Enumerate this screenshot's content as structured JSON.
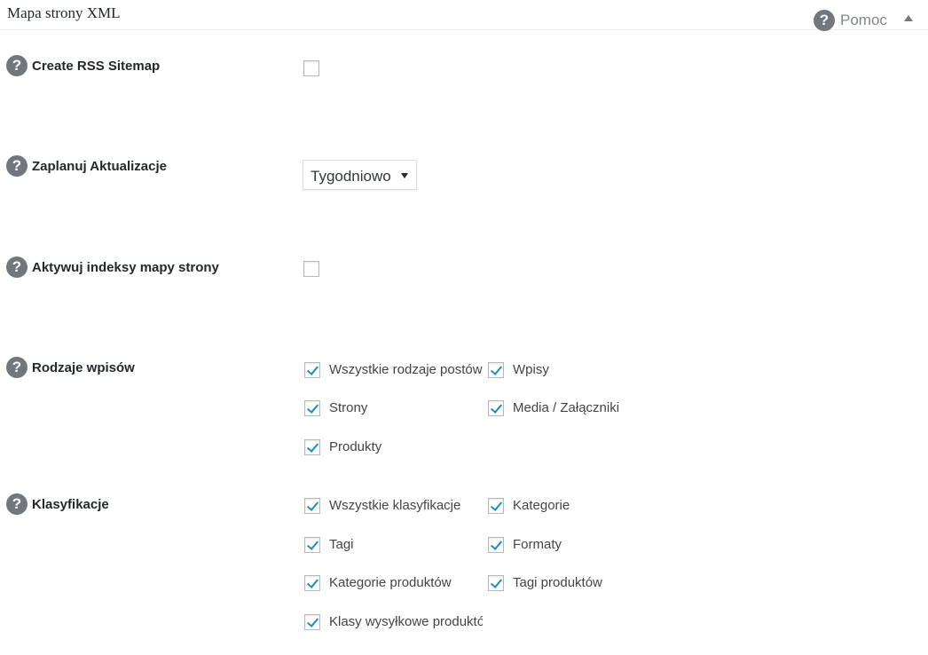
{
  "header": {
    "title": "Mapa strony XML",
    "help_label": "Pomoc"
  },
  "settings": {
    "rss": {
      "label": "Create RSS Sitemap",
      "checked": false
    },
    "schedule": {
      "label": "Zaplanuj Aktualizacje",
      "selected": "Tygodniowo"
    },
    "indexes": {
      "label": "Aktywuj indeksy mapy strony",
      "checked": false
    },
    "post_types": {
      "label": "Rodzaje wpisów",
      "options": [
        {
          "label": "Wszystkie rodzaje postów",
          "checked": true
        },
        {
          "label": "Wpisy",
          "checked": true
        },
        {
          "label": "Strony",
          "checked": true
        },
        {
          "label": "Media / Załączniki",
          "checked": true
        },
        {
          "label": "Produkty",
          "checked": true
        }
      ]
    },
    "taxonomies": {
      "label": "Klasyfikacje",
      "options": [
        {
          "label": "Wszystkie klasyfikacje",
          "checked": true
        },
        {
          "label": "Kategorie",
          "checked": true
        },
        {
          "label": "Tagi",
          "checked": true
        },
        {
          "label": "Formaty",
          "checked": true
        },
        {
          "label": "Kategorie produktów",
          "checked": true
        },
        {
          "label": "Tagi produktów",
          "checked": true
        },
        {
          "label": "Klasy wysyłkowe produktów",
          "checked": true
        }
      ]
    }
  },
  "colors": {
    "check_accent": "#1e8cbe",
    "help_icon_bg": "#72777c"
  },
  "icons": {
    "help": "question-circle-icon",
    "collapse": "triangle-up-icon",
    "select_caret": "caret-down-icon",
    "check": "checkmark-icon"
  }
}
